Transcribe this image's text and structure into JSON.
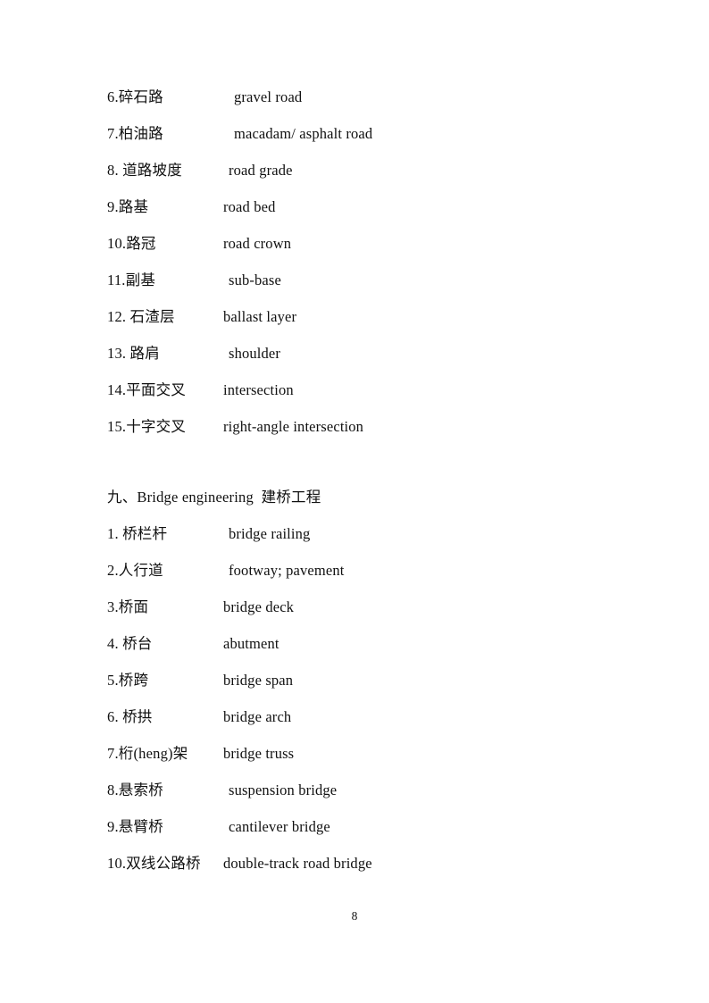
{
  "document": {
    "page_number": "8",
    "text_color": "#111111",
    "background_color": "#ffffff"
  },
  "road_section": {
    "entries": [
      {
        "term": "6.碎石路",
        "gloss": "gravel  road",
        "indent": 2
      },
      {
        "term": "7.柏油路",
        "gloss": "macadam/ asphalt  road",
        "indent": 2
      },
      {
        "term": "8. 道路坡度",
        "gloss": "road  grade",
        "indent": 1
      },
      {
        "term": "9.路基",
        "gloss": "road  bed",
        "indent": 0
      },
      {
        "term": "10.路冠",
        "gloss": "road   crown",
        "indent": 0
      },
      {
        "term": "11.副基",
        "gloss": "sub-base",
        "indent": 1
      },
      {
        "term": "12. 石渣层",
        "gloss": "ballast  layer",
        "indent": 0
      },
      {
        "term": "13. 路肩",
        "gloss": "shoulder",
        "indent": 1
      },
      {
        "term": "14.平面交叉",
        "gloss": "intersection",
        "indent": 0
      },
      {
        "term": "15.十字交叉",
        "gloss": "right-angle  intersection",
        "indent": 0
      }
    ]
  },
  "bridge_section": {
    "heading": {
      "number": "九、",
      "english": "Bridge   engineering",
      "chinese": "建桥工程"
    },
    "entries": [
      {
        "term": "1. 桥栏杆",
        "gloss": "bridge  railing",
        "indent": 1
      },
      {
        "term": "2.人行道",
        "gloss": "footway;  pavement",
        "indent": 1
      },
      {
        "term": "3.桥面",
        "gloss": "bridge  deck",
        "indent": 0
      },
      {
        "term": "4. 桥台",
        "gloss": "abutment",
        "indent": 0
      },
      {
        "term": "5.桥跨",
        "gloss": "bridge  span",
        "indent": 0
      },
      {
        "term": "6. 桥拱",
        "gloss": "bridge  arch",
        "indent": 0
      },
      {
        "term": "7.桁(heng)架",
        "gloss": "bridge   truss",
        "indent": 0
      },
      {
        "term": "8.悬索桥",
        "gloss": "suspension  bridge",
        "indent": 1
      },
      {
        "term": "9.悬臂桥",
        "gloss": "cantilever  bridge",
        "indent": 1
      },
      {
        "term": "10.双线公路桥",
        "gloss": "double-track  road  bridge",
        "indent": 0
      }
    ]
  }
}
